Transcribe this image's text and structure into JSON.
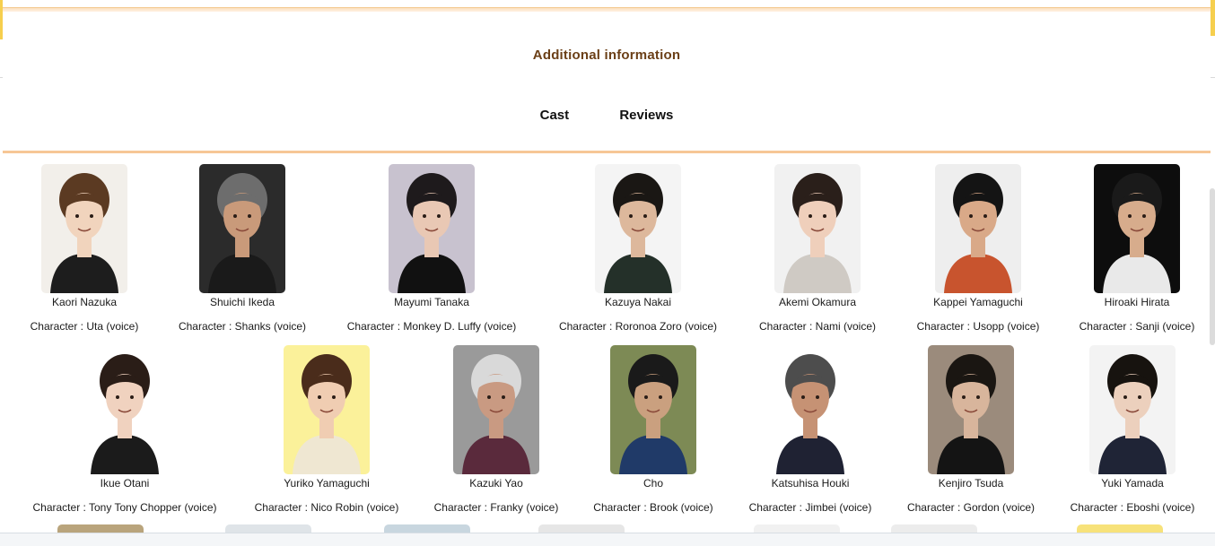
{
  "section": {
    "title": "Additional information",
    "tabs": [
      "Cast",
      "Reviews"
    ]
  },
  "cast_row1": [
    {
      "name": "Kaori Nazuka",
      "role": "Character : Uta (voice)",
      "bg": "#f2efea",
      "hair": "#5b3a22",
      "skin": "#f1d4bd",
      "cloth": "#1d1d1d"
    },
    {
      "name": "Shuichi Ikeda",
      "role": "Character : Shanks (voice)",
      "bg": "#2b2b2b",
      "hair": "#6d6d6d",
      "skin": "#c99a7a",
      "cloth": "#1a1a1a"
    },
    {
      "name": "Mayumi Tanaka",
      "role": "Character : Monkey D. Luffy (voice)",
      "bg": "#c8c2cf",
      "hair": "#1e1a1c",
      "skin": "#e9c8b4",
      "cloth": "#111111"
    },
    {
      "name": "Kazuya Nakai",
      "role": "Character : Roronoa Zoro (voice)",
      "bg": "#f4f4f4",
      "hair": "#1a1714",
      "skin": "#ddb89c",
      "cloth": "#243029"
    },
    {
      "name": "Akemi Okamura",
      "role": "Character : Nami (voice)",
      "bg": "#f1f1f1",
      "hair": "#2a1f1a",
      "skin": "#efcfbb",
      "cloth": "#cfcac4"
    },
    {
      "name": "Kappei Yamaguchi",
      "role": "Character : Usopp (voice)",
      "bg": "#eeeeee",
      "hair": "#141414",
      "skin": "#d9a988",
      "cloth": "#c8542e"
    },
    {
      "name": "Hiroaki Hirata",
      "role": "Character : Sanji (voice)",
      "bg": "#0d0d0d",
      "hair": "#1a1a1a",
      "skin": "#d7ac8c",
      "cloth": "#e9e9e9"
    }
  ],
  "cast_row2": [
    {
      "name": "Ikue Otani",
      "role": "Character : Tony Tony Chopper (voice)",
      "bg": "#ffffff",
      "hair": "#2a1d17",
      "skin": "#f0d2bf",
      "cloth": "#1b1b1b"
    },
    {
      "name": "Yuriko Yamaguchi",
      "role": "Character : Nico Robin (voice)",
      "bg": "#fbf19a",
      "hair": "#4a2c1b",
      "skin": "#f0cdb2",
      "cloth": "#efe7d2"
    },
    {
      "name": "Kazuki Yao",
      "role": "Character : Franky (voice)",
      "bg": "#9a9a9a",
      "hair": "#d9d9d9",
      "skin": "#c99a82",
      "cloth": "#5a2a3c"
    },
    {
      "name": "Cho",
      "role": "Character : Brook (voice)",
      "bg": "#7d8a55",
      "hair": "#1a1a1a",
      "skin": "#caa07f",
      "cloth": "#203a68"
    },
    {
      "name": "Katsuhisa Houki",
      "role": "Character : Jimbei (voice)",
      "bg": "#ffffff",
      "hair": "#4d4d4d",
      "skin": "#c69274",
      "cloth": "#1f2233"
    },
    {
      "name": "Kenjiro Tsuda",
      "role": "Character : Gordon (voice)",
      "bg": "#9b8b7c",
      "hair": "#1a1612",
      "skin": "#d8b59c",
      "cloth": "#141414"
    },
    {
      "name": "Yuki Yamada",
      "role": "Character : Eboshi (voice)",
      "bg": "#f3f3f3",
      "hair": "#17130f",
      "skin": "#ecd0bd",
      "cloth": "#1f2436"
    }
  ],
  "partial_row_colors": [
    "#b9a47c",
    "#dfe4e8",
    "#c8d6df",
    "#e6e6e6",
    "#f1f1f1",
    "#ececec",
    "#f7e27a"
  ]
}
